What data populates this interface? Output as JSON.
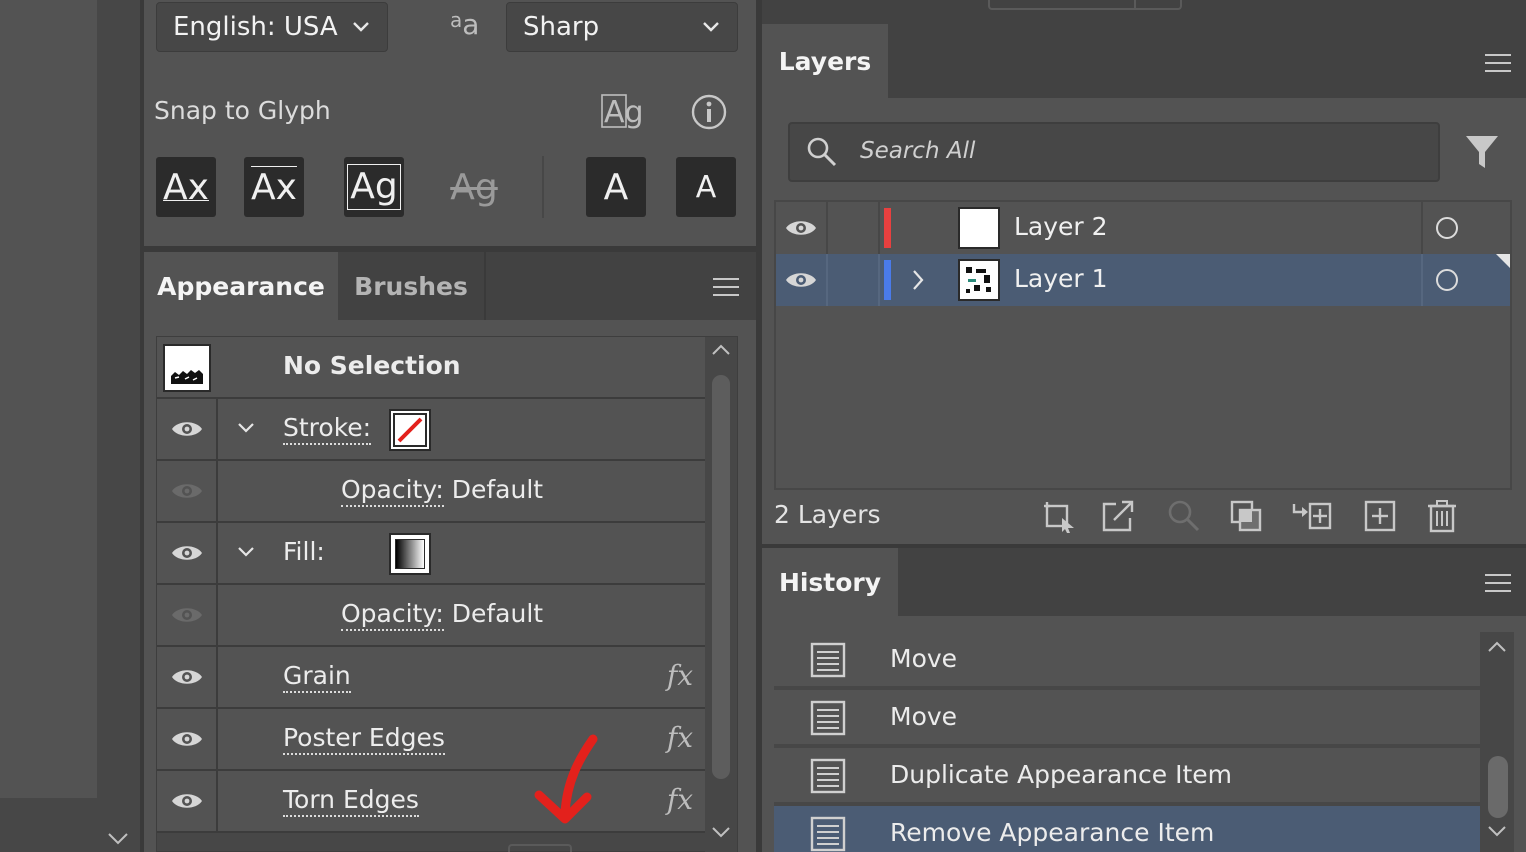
{
  "character": {
    "language": "English: USA",
    "antialias": "Sharp",
    "snap_label": "Snap to Glyph",
    "snap_buttons": [
      "Ax",
      "Ax",
      "Ag",
      "Ag",
      "A",
      "A"
    ]
  },
  "appearance": {
    "tabs": [
      {
        "label": "Appearance"
      },
      {
        "label": "Brushes"
      }
    ],
    "header": "No Selection",
    "rows": [
      {
        "label": "Stroke:"
      },
      {
        "label": "Opacity:",
        "value": "Default"
      },
      {
        "label": "Fill:"
      },
      {
        "label": "Opacity:",
        "value": "Default"
      },
      {
        "label": "Grain",
        "fx": "fx"
      },
      {
        "label": "Poster Edges",
        "fx": "fx"
      },
      {
        "label": "Torn Edges",
        "fx": "fx"
      }
    ],
    "annotation_color": "#e3211c"
  },
  "layers": {
    "tab": "Layers",
    "search_placeholder": "Search All",
    "items": [
      {
        "name": "Layer 2",
        "color": "#e8403f"
      },
      {
        "name": "Layer 1",
        "color": "#4a7bea"
      }
    ],
    "count": "2 Layers",
    "selection_color": "#4b5c74"
  },
  "history": {
    "tab": "History",
    "items": [
      "Move",
      "Move",
      "Duplicate Appearance Item",
      "Remove Appearance Item"
    ]
  }
}
